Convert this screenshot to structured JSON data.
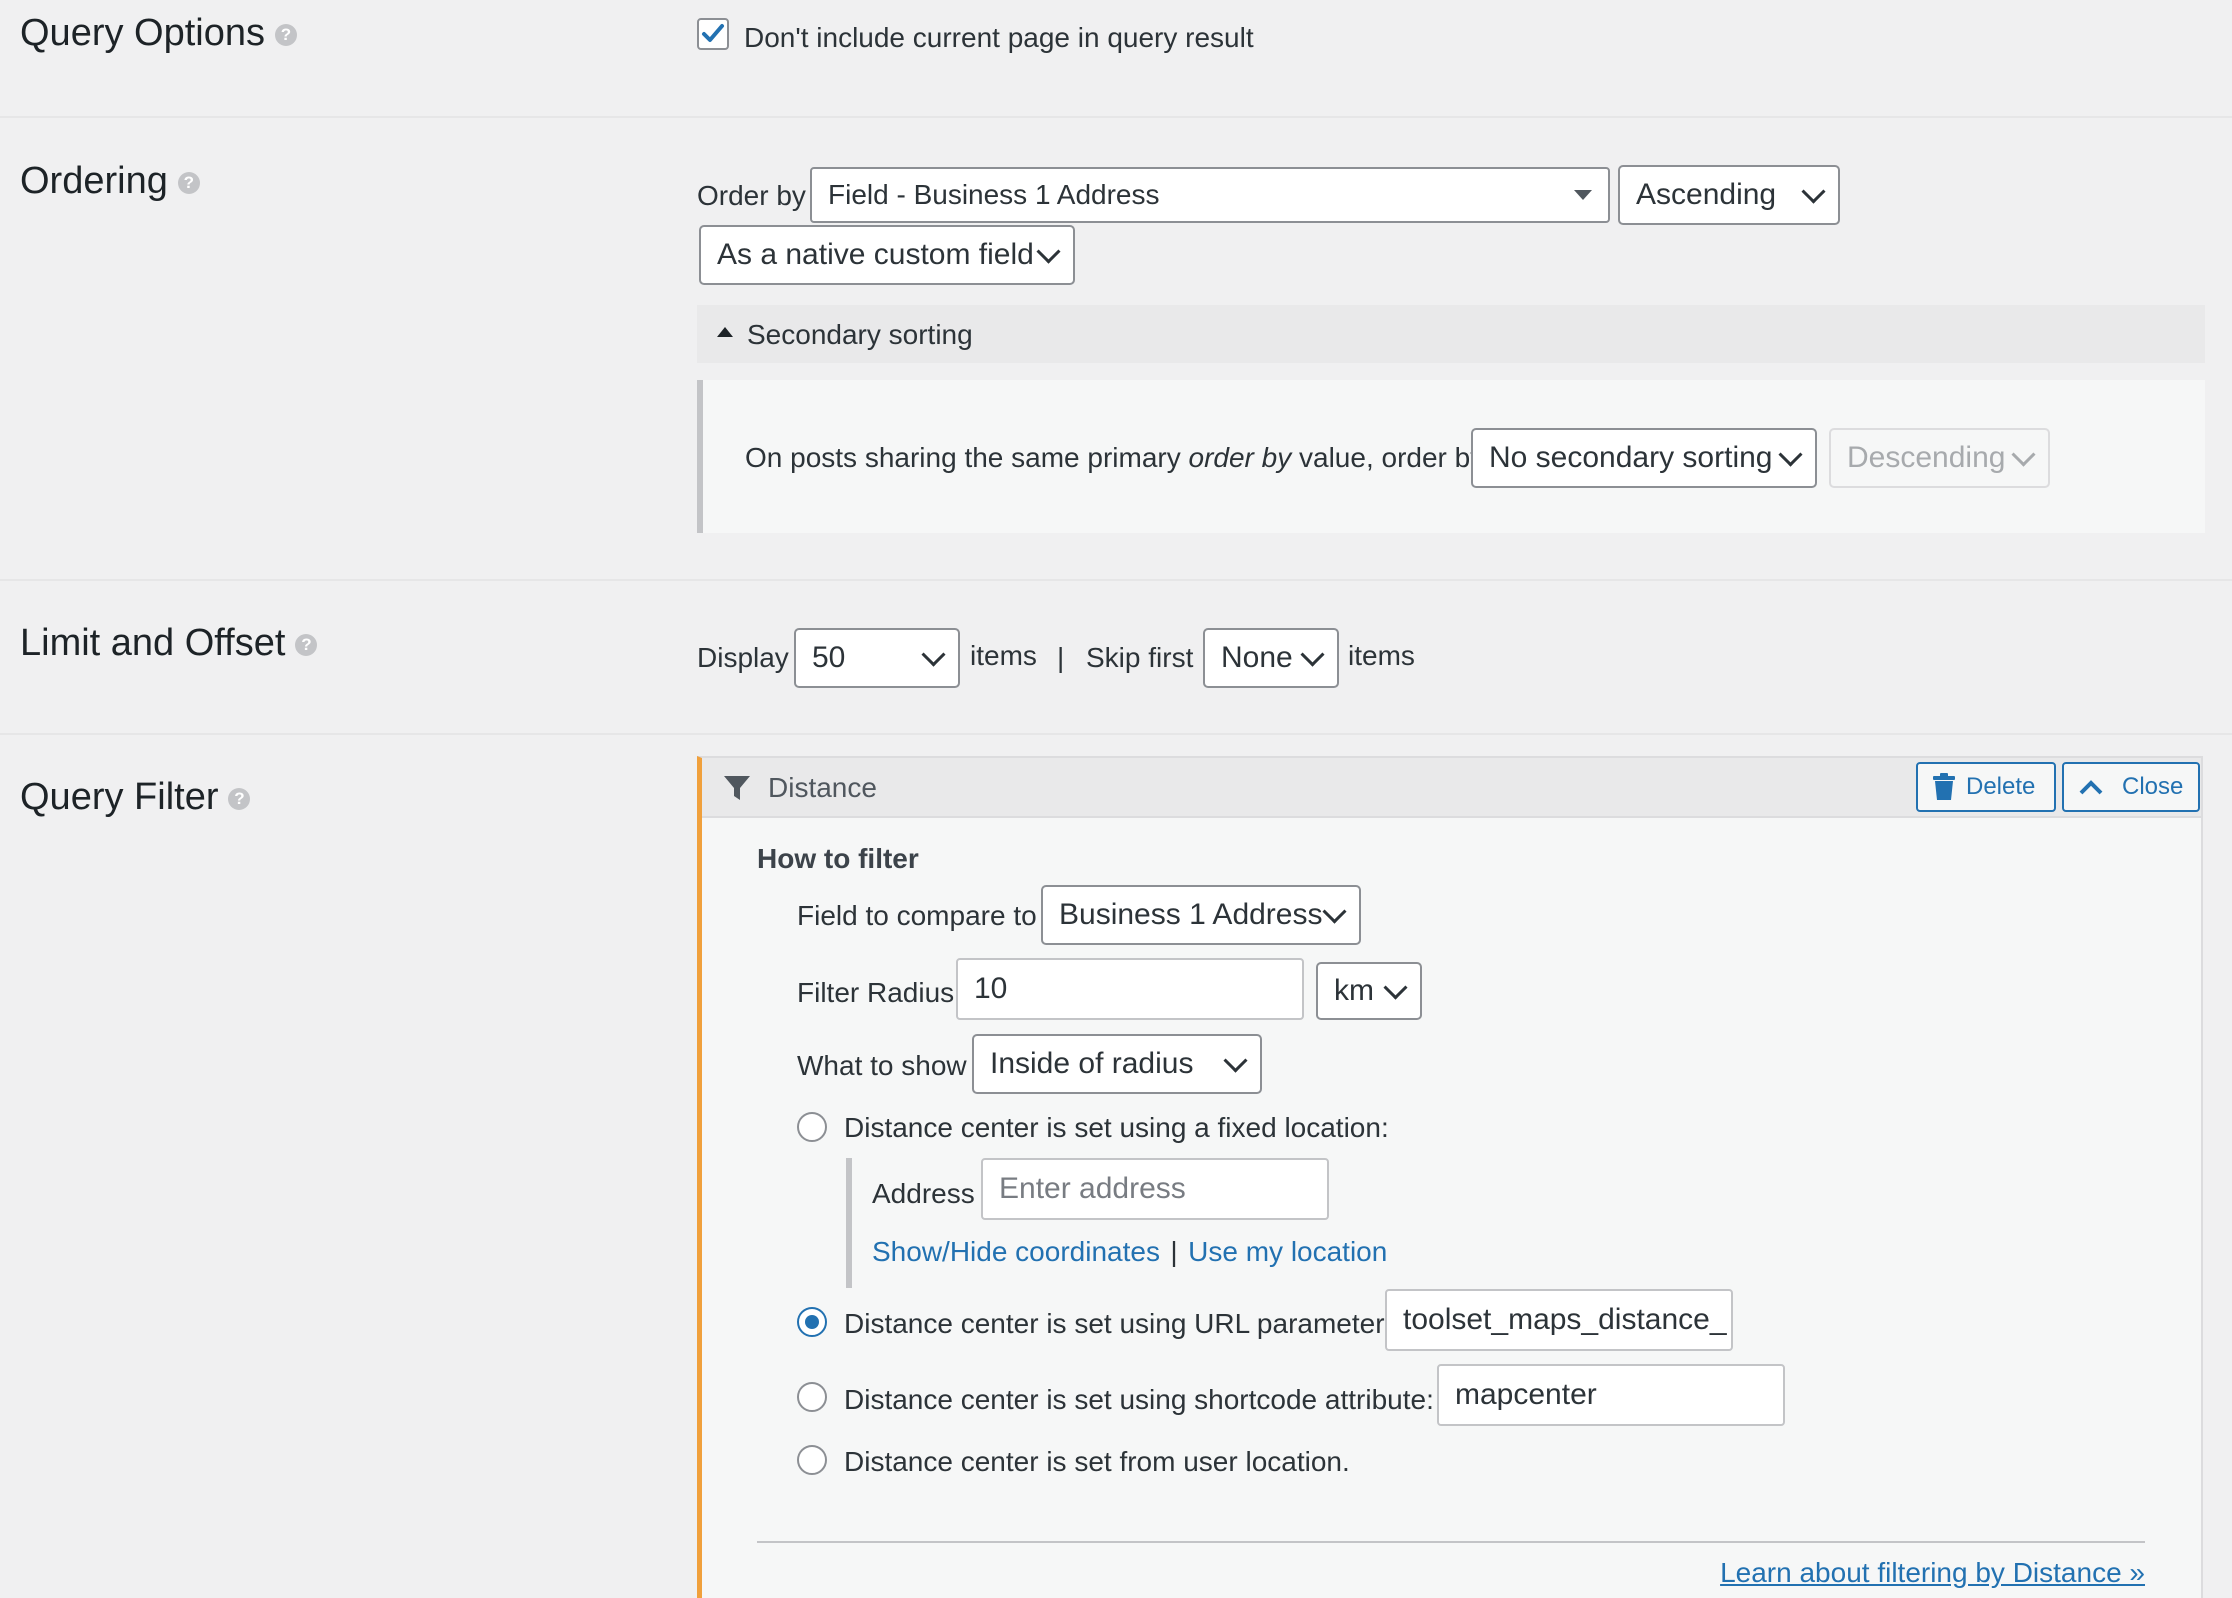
{
  "query_options": {
    "title": "Query Options",
    "help": "?",
    "exclude_current_label": "Don't include current page in query result",
    "exclude_current_checked": true
  },
  "ordering": {
    "title": "Ordering",
    "help": "?",
    "order_by_label": "Order by",
    "order_by_value": "Field - Business 1 Address",
    "direction_value": "Ascending",
    "field_type_value": "As a native custom field",
    "secondary_toggle_label": "Secondary sorting",
    "secondary_text_before": "On posts sharing the same primary ",
    "secondary_text_em": "order by",
    "secondary_text_after": " value, order by",
    "secondary_value": "No secondary sorting",
    "secondary_direction_value": "Descending"
  },
  "limit_offset": {
    "title": "Limit and Offset",
    "help": "?",
    "display_label": "Display",
    "display_value": "50",
    "items_label": "items",
    "separator": "|",
    "skip_label": "Skip first",
    "skip_value": "None",
    "items_label_2": "items"
  },
  "query_filter": {
    "title": "Query Filter",
    "help": "?",
    "panel_title": "Distance",
    "delete_label": "Delete",
    "close_label": "Close",
    "how_to_filter": "How to filter",
    "field_compare_label": "Field to compare to",
    "field_compare_value": "Business 1 Address",
    "radius_label": "Filter Radius",
    "radius_value": "10",
    "unit_value": "km",
    "what_to_show_label": "What to show",
    "what_to_show_value": "Inside of radius",
    "options": {
      "fixed_label": "Distance center is set using a fixed location:",
      "address_label": "Address",
      "address_placeholder": "Enter address",
      "show_hide_coords": "Show/Hide coordinates",
      "link_separator": "|",
      "use_my_location": "Use my location",
      "url_label": "Distance center is set using URL parameter:",
      "url_value": "toolset_maps_distance_",
      "shortcode_label": "Distance center is set using shortcode attribute:",
      "shortcode_value": "mapcenter",
      "user_location_label": "Distance center is set from user location."
    },
    "selected_option": "url",
    "learn_link": "Learn about filtering by Distance »"
  },
  "colors": {
    "accent": "#2271b1",
    "filter_border": "#f0a03c",
    "background": "#f0f0f1"
  }
}
